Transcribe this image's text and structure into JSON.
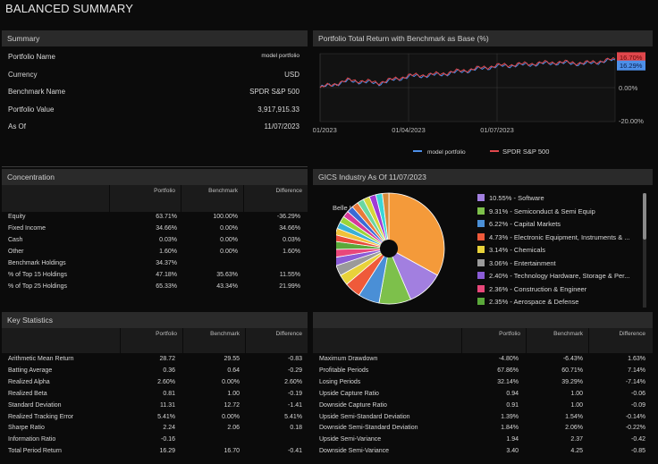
{
  "page_title": "BALANCED SUMMARY",
  "summary": {
    "header": "Summary",
    "rows": [
      {
        "label": "Portfolio Name",
        "value": "model portfolio"
      },
      {
        "label": "Currency",
        "value": "USD"
      },
      {
        "label": "Benchmark Name",
        "value": "SPDR S&P 500"
      },
      {
        "label": "Portfolio Value",
        "value": "3,917,915.33"
      },
      {
        "label": "As Of",
        "value": "11/07/2023"
      }
    ]
  },
  "performance": {
    "header": "Portfolio Total Return with Benchmark as Base (%)",
    "x_ticks": [
      "01/01/2023",
      "01/04/2023",
      "01/07/2023"
    ],
    "y_ticks": [
      "0.00%",
      "-20.00%"
    ],
    "end_labels": {
      "benchmark": "16.70%",
      "portfolio": "16.29%"
    },
    "legend": {
      "portfolio": "model portfolio",
      "benchmark": "SPDR S&P 500"
    },
    "colors": {
      "portfolio": "#4d8fe8",
      "benchmark": "#e0474c"
    }
  },
  "chart_data": {
    "type": "line",
    "x": [
      "01/01/2023",
      "01/02/2023",
      "01/03/2023",
      "01/04/2023",
      "01/05/2023",
      "01/06/2023",
      "01/07/2023",
      "01/08/2023",
      "01/09/2023",
      "01/10/2023",
      "11/07/2023"
    ],
    "series": [
      {
        "name": "model portfolio",
        "values": [
          0,
          4,
          2.5,
          6.5,
          7.5,
          10,
          12.5,
          13.5,
          14.5,
          14,
          16.29
        ]
      },
      {
        "name": "SPDR S&P 500",
        "values": [
          0,
          4.5,
          3,
          7,
          8,
          10.5,
          13,
          14,
          15,
          14.5,
          16.7
        ]
      }
    ],
    "ylim": [
      -20,
      20
    ]
  },
  "concentration": {
    "header": "Concentration",
    "columns": [
      "Portfolio",
      "Benchmark",
      "Difference"
    ],
    "rows": [
      {
        "label": "Equity",
        "p": "63.71%",
        "b": "100.00%",
        "d": "-36.29%"
      },
      {
        "label": "Fixed Income",
        "p": "34.66%",
        "b": "0.00%",
        "d": "34.66%"
      },
      {
        "label": "Cash",
        "p": "0.03%",
        "b": "0.00%",
        "d": "0.03%"
      },
      {
        "label": "Other",
        "p": "1.60%",
        "b": "0.00%",
        "d": "1.60%"
      },
      {
        "label": "Benchmark Holdings",
        "p": "34.37%",
        "b": "",
        "d": ""
      },
      {
        "label": "% of Top 15 Holdings",
        "p": "47.18%",
        "b": "35.63%",
        "d": "11.55%"
      },
      {
        "label": "% of Top 25 Holdings",
        "p": "65.33%",
        "b": "43.34%",
        "d": "21.99%"
      }
    ]
  },
  "gics": {
    "header": "GICS Industry As Of 11/07/2023",
    "pie_label": "Belle Isle",
    "items": [
      {
        "label": "10.55% - Software",
        "pct": 10.55,
        "color": "#a27fe0"
      },
      {
        "label": "9.31% - Semiconduct & Semi Equip",
        "pct": 9.31,
        "color": "#7dc04b"
      },
      {
        "label": "6.22% - Capital Markets",
        "pct": 6.22,
        "color": "#4a8fd6"
      },
      {
        "label": "4.73% - Electronic Equipment, Instruments & ...",
        "pct": 4.73,
        "color": "#ef5a3a"
      },
      {
        "label": "3.14% - Chemicals",
        "pct": 3.14,
        "color": "#e8d23a"
      },
      {
        "label": "3.06% - Entertainment",
        "pct": 3.06,
        "color": "#9a9a9a"
      },
      {
        "label": "2.40% - Technology Hardware, Storage & Per...",
        "pct": 2.4,
        "color": "#8a5cd6"
      },
      {
        "label": "2.36% - Construction & Engineer",
        "pct": 2.36,
        "color": "#e8477a"
      },
      {
        "label": "2.35% - Aerospace & Defense",
        "pct": 2.35,
        "color": "#5aa83a"
      }
    ],
    "large_slice_color": "#f49a3a",
    "other_slice_colors": [
      "#e84a3a",
      "#f0c23a",
      "#3ab0d6",
      "#9cd43a",
      "#d63a9a",
      "#3a6ad6",
      "#e87a3a",
      "#6ad6a0",
      "#d6d63a",
      "#a03ad6",
      "#3ad6d6",
      "#d68a3a"
    ]
  },
  "key_stats": {
    "header": "Key Statistics",
    "columns": [
      "Portfolio",
      "Benchmark",
      "Difference"
    ],
    "left": [
      {
        "label": "Arithmetic Mean Return",
        "p": "28.72",
        "b": "29.55",
        "d": "-0.83"
      },
      {
        "label": "Batting Average",
        "p": "0.36",
        "b": "0.64",
        "d": "-0.29"
      },
      {
        "label": "Realized Alpha",
        "p": "2.60%",
        "b": "0.00%",
        "d": "2.60%"
      },
      {
        "label": "Realized Beta",
        "p": "0.81",
        "b": "1.00",
        "d": "-0.19"
      },
      {
        "label": "Standard Deviation",
        "p": "11.31",
        "b": "12.72",
        "d": "-1.41"
      },
      {
        "label": "Realized Tracking Error",
        "p": "5.41%",
        "b": "0.00%",
        "d": "5.41%"
      },
      {
        "label": "Sharpe Ratio",
        "p": "2.24",
        "b": "2.06",
        "d": "0.18"
      },
      {
        "label": "Information Ratio",
        "p": "-0.16",
        "b": "",
        "d": ""
      },
      {
        "label": "Total Period Return",
        "p": "16.29",
        "b": "16.70",
        "d": "-0.41"
      }
    ],
    "right": [
      {
        "label": "Maximum Drawdown",
        "p": "-4.80%",
        "b": "-6.43%",
        "d": "1.63%"
      },
      {
        "label": "Profitable Periods",
        "p": "67.86%",
        "b": "60.71%",
        "d": "7.14%"
      },
      {
        "label": "Losing Periods",
        "p": "32.14%",
        "b": "39.29%",
        "d": "-7.14%"
      },
      {
        "label": "Upside Capture Ratio",
        "p": "0.94",
        "b": "1.00",
        "d": "-0.06"
      },
      {
        "label": "Downside Capture Ratio",
        "p": "0.91",
        "b": "1.00",
        "d": "-0.09"
      },
      {
        "label": "Upside Semi-Standard Deviation",
        "p": "1.39%",
        "b": "1.54%",
        "d": "-0.14%"
      },
      {
        "label": "Downside Semi-Standard Deviation",
        "p": "1.84%",
        "b": "2.06%",
        "d": "-0.22%"
      },
      {
        "label": "Upside Semi-Variance",
        "p": "1.94",
        "b": "2.37",
        "d": "-0.42"
      },
      {
        "label": "Downside Semi-Variance",
        "p": "3.40",
        "b": "4.25",
        "d": "-0.85"
      }
    ]
  }
}
